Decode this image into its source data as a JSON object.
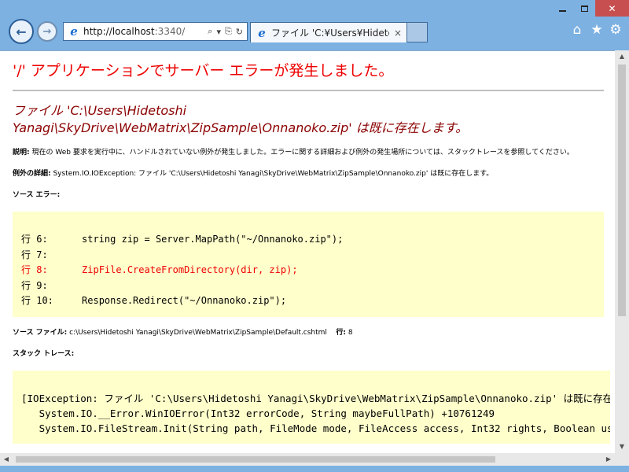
{
  "browser": {
    "address_url_host": "http://localhost",
    "address_url_rest": ":3340/",
    "tab_title": "ファイル 'C:¥Users¥Hideto...",
    "back_glyph": "←",
    "forward_glyph": "→",
    "tab_close_glyph": "×",
    "ie_glyph": "e",
    "search_glyph": "⌕",
    "dropdown_glyph": "▾",
    "compat_glyph": "⎘",
    "refresh_glyph": "↻",
    "home_glyph": "⌂",
    "favorites_glyph": "★",
    "tools_glyph": "⚙",
    "close_glyph": "✕",
    "icons": [
      "back-icon",
      "forward-icon",
      "ie-icon",
      "search-icon",
      "compat-view-icon",
      "refresh-icon",
      "home-icon",
      "favorites-icon",
      "tools-icon"
    ]
  },
  "page": {
    "title": "'/' アプリケーションでサーバー エラーが発生しました。",
    "error_heading_line1": "ファイル 'C:\\Users\\Hidetoshi",
    "error_heading_line2": "Yanagi\\SkyDrive\\WebMatrix\\ZipSample\\Onnanoko.zip' は既に存在します。",
    "description_label": "説明:",
    "description_text": " 現在の Web 要求を実行中に、ハンドルされていない例外が発生しました。エラーに関する詳細および例外の発生場所については、スタックトレースを参照してください。",
    "exception_label": "例外の詳細:",
    "exception_text": " System.IO.IOException: ファイル 'C:\\Users\\Hidetoshi Yanagi\\SkyDrive\\WebMatrix\\ZipSample\\Onnanoko.zip' は既に存在します。",
    "source_error_label": "ソース エラー:",
    "code_lines": [
      "行 6:      string zip = Server.MapPath(\"~/Onnanoko.zip\");",
      "行 7:",
      "行 8:      ZipFile.CreateFromDirectory(dir, zip);",
      "行 9:",
      "行 10:     Response.Redirect(\"~/Onnanoko.zip\");"
    ],
    "source_file_label": "ソース ファイル:",
    "source_file_text": " c:\\Users\\Hidetoshi Yanagi\\SkyDrive\\WebMatrix\\ZipSample\\Default.cshtml",
    "line_label": "行:",
    "line_number": " 8",
    "stack_trace_label": "スタック トレース:",
    "stack_lines": [
      "[IOException: ファイル 'C:\\Users\\Hidetoshi Yanagi\\SkyDrive\\WebMatrix\\ZipSample\\Onnanoko.zip' は既に存在します。]",
      "   System.IO.__Error.WinIOError(Int32 errorCode, String maybeFullPath) +10761249",
      "   System.IO.FileStream.Init(String path, FileMode mode, FileAccess access, Int32 rights, Boolean useRights"
    ]
  },
  "colors": {
    "error_title": "#e00000",
    "error_heading": "#8b0000",
    "code_bg": "#ffffcc",
    "highlight_line": "#e00000",
    "browser_frame": "#7cb1e2",
    "close_button": "#c74f4f"
  }
}
